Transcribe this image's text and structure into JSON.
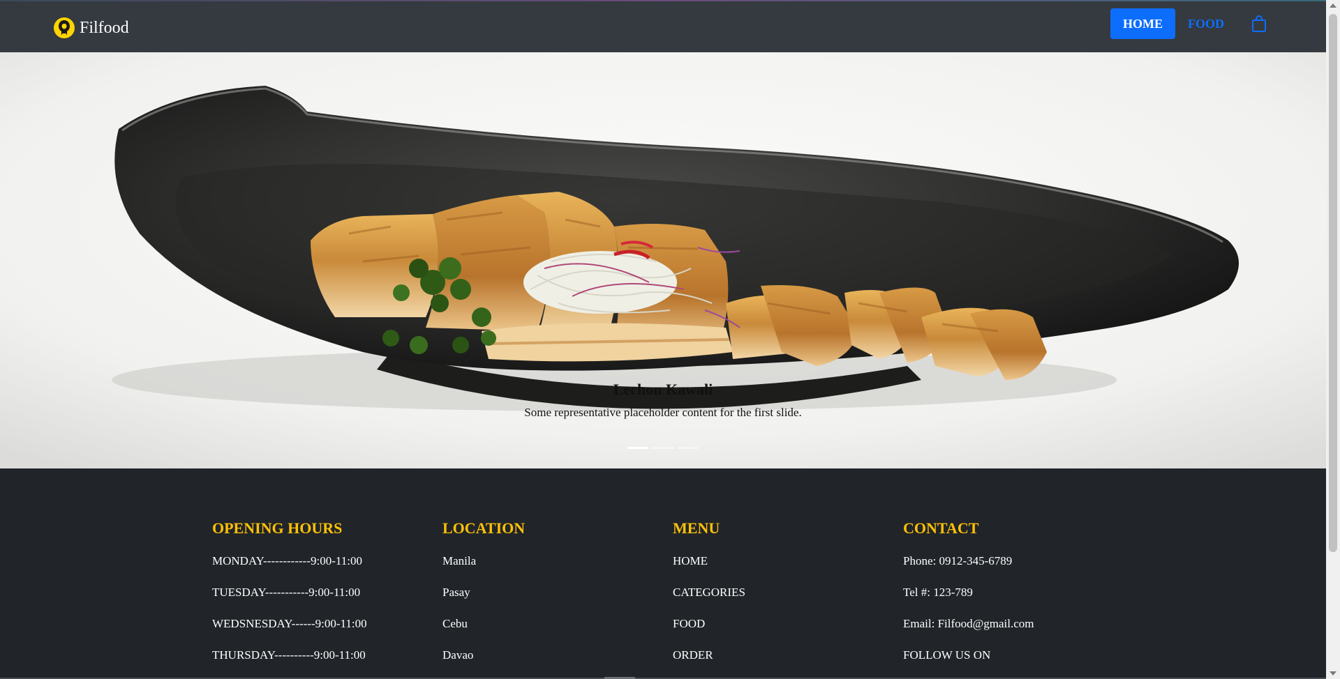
{
  "navbar": {
    "brand": "Filfood",
    "links": [
      {
        "label": "HOME",
        "active": true
      },
      {
        "label": "FOOD",
        "active": false
      }
    ],
    "cart_icon": "shopping-bag-icon",
    "logo_icon": "chef-head-logo-icon"
  },
  "carousel": {
    "slides": [
      {
        "title": "Lechon Kawali",
        "text": "Some representative placeholder content for the first slide.",
        "image": "fried pork belly on dark stone plate"
      }
    ],
    "indicator_count": 3,
    "active_index": 0
  },
  "footer": {
    "columns": [
      {
        "heading": "OPENING HOURS",
        "items": [
          "MONDAY------------9:00-11:00",
          "TUESDAY-----------9:00-11:00",
          "WEDSNESDAY------9:00-11:00",
          "THURSDAY----------9:00-11:00"
        ]
      },
      {
        "heading": "LOCATION",
        "items": [
          "Manila",
          "Pasay",
          "Cebu",
          "Davao"
        ]
      },
      {
        "heading": "MENU",
        "items": [
          "HOME",
          "CATEGORIES",
          "FOOD",
          "ORDER"
        ]
      },
      {
        "heading": "CONTACT",
        "items": [
          "Phone: 0912-345-6789",
          "Tel #: 123-789",
          "Email: Filfood@gmail.com",
          "FOLLOW US ON"
        ]
      }
    ]
  },
  "colors": {
    "navbar_bg": "#343a40",
    "footer_bg": "#212529",
    "primary": "#0d6efd",
    "footer_heading": "#ffc107"
  }
}
